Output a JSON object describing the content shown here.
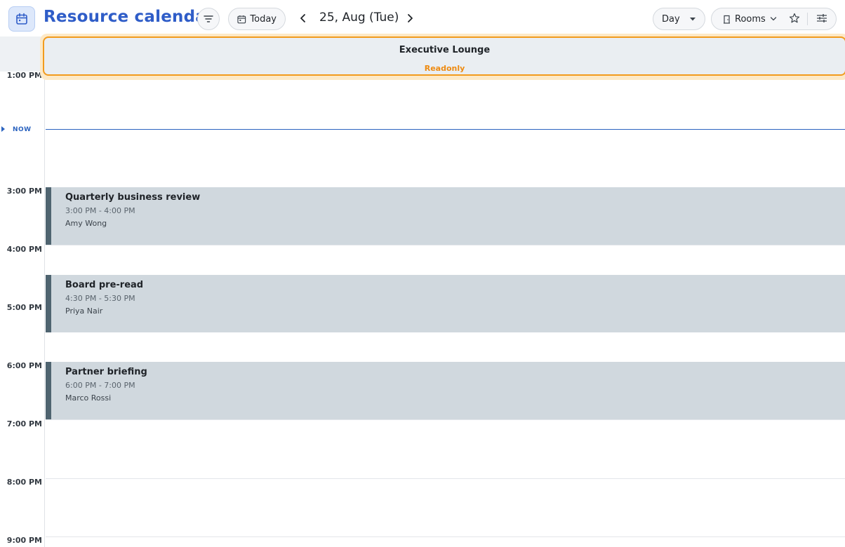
{
  "header": {
    "title": "Resource calendar",
    "today_label": "Today",
    "date_label": "25, Aug (Tue)",
    "view_label": "Day",
    "group_label": "Rooms"
  },
  "resource": {
    "name": "Executive Lounge",
    "status": "Readonly"
  },
  "now_label": "NOW",
  "time_slots": [
    {
      "label": "1:00 PM"
    },
    {
      "label": "3:00 PM"
    },
    {
      "label": "4:00 PM"
    },
    {
      "label": "5:00 PM"
    },
    {
      "label": "6:00 PM"
    },
    {
      "label": "7:00 PM"
    },
    {
      "label": "8:00 PM"
    },
    {
      "label": "9:00 PM"
    }
  ],
  "events": [
    {
      "title": "Quarterly business review",
      "time": "3:00 PM - 4:00 PM",
      "person": "Amy Wong"
    },
    {
      "title": "Board pre-read",
      "time": "4:30 PM - 5:30 PM",
      "person": "Priya Nair"
    },
    {
      "title": "Partner briefing",
      "time": "6:00 PM - 7:00 PM",
      "person": "Marco Rossi"
    }
  ],
  "colors": {
    "accent": "#2f5dc8",
    "now": "#2b63bf",
    "readonly": "#ee8b12",
    "event_bg": "#d0d8de",
    "event_bar": "#4f6470"
  }
}
